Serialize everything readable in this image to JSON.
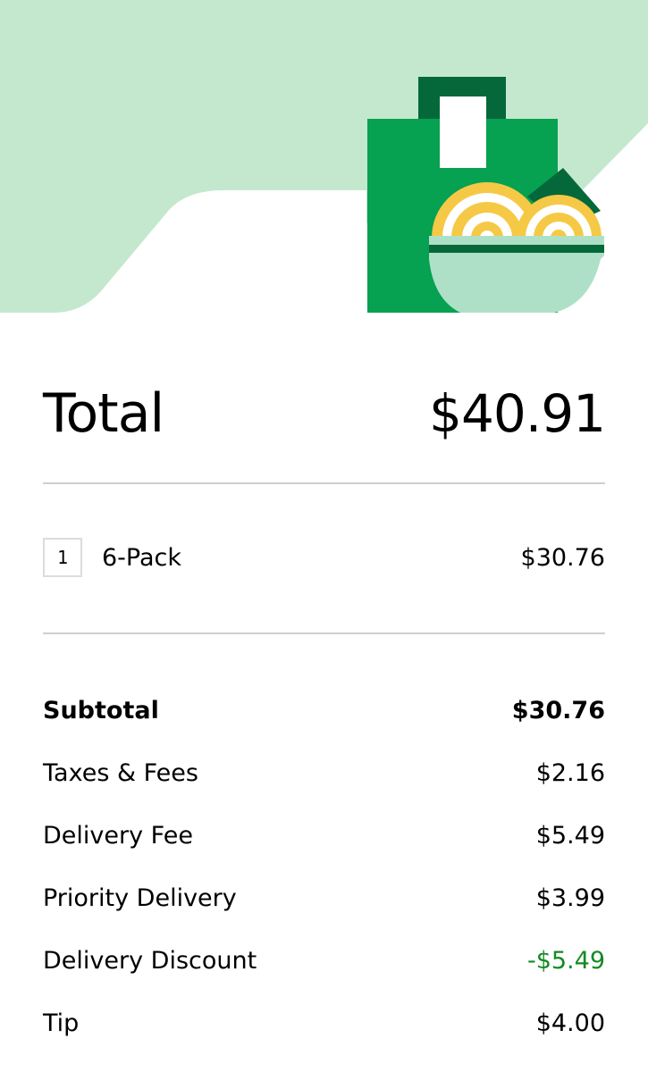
{
  "header": {
    "illustration": "grocery-bag-with-noodle-bowl"
  },
  "total": {
    "label": "Total",
    "value": "$40.91"
  },
  "items": [
    {
      "quantity": "1",
      "name": "6-Pack",
      "price": "$30.76"
    }
  ],
  "fees": [
    {
      "label": "Subtotal",
      "value": "$30.76"
    },
    {
      "label": "Taxes & Fees",
      "value": "$2.16"
    },
    {
      "label": "Delivery Fee",
      "value": "$5.49"
    },
    {
      "label": "Priority Delivery",
      "value": "$3.99"
    },
    {
      "label": "Delivery Discount",
      "value": "-$5.49"
    },
    {
      "label": "Tip",
      "value": "$4.00"
    }
  ],
  "colors": {
    "hero_background": "#c4e8cd",
    "bag_green": "#06a151",
    "bag_dark_green": "#05683a",
    "bowl": "#aee0c8",
    "noodles": "#f5c945",
    "discount_green": "#138a23"
  }
}
